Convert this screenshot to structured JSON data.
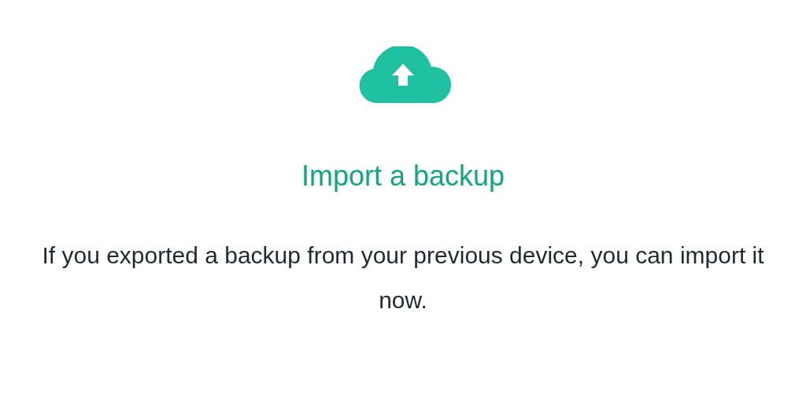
{
  "title": "Import a backup",
  "message": "If you exported a backup from your previous device, you can import it now."
}
